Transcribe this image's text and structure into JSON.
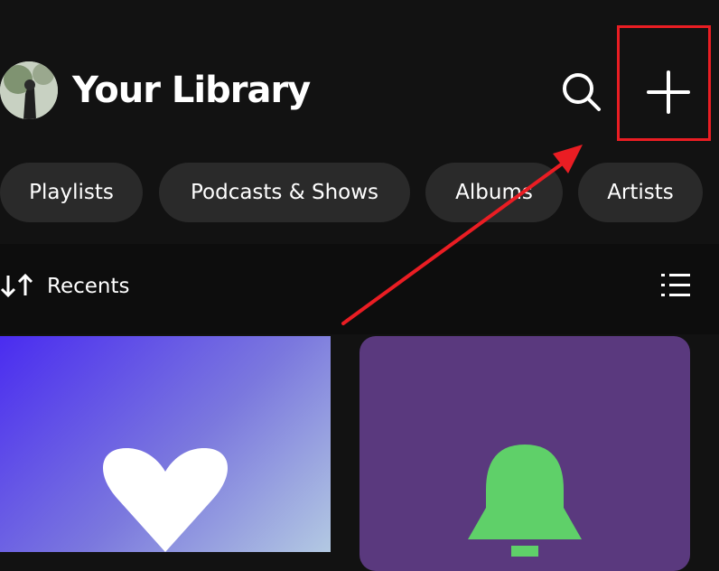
{
  "header": {
    "title": "Your Library"
  },
  "filters": [
    "Playlists",
    "Podcasts & Shows",
    "Albums",
    "Artists"
  ],
  "sort": {
    "label": "Recents"
  },
  "icons": {
    "search": "search-icon",
    "add": "plus-icon",
    "sort": "sort-arrows-icon",
    "view": "list-view-icon",
    "liked": "heart-icon",
    "episodes": "bell-icon"
  },
  "colors": {
    "background": "#121212",
    "chip": "#2a2a2a",
    "annotation": "#ea1d23",
    "liked_gradient_start": "#4a2cf0",
    "liked_gradient_end": "#b3c9e2",
    "episodes_bg": "#5a397e",
    "bell": "#5fd069"
  }
}
